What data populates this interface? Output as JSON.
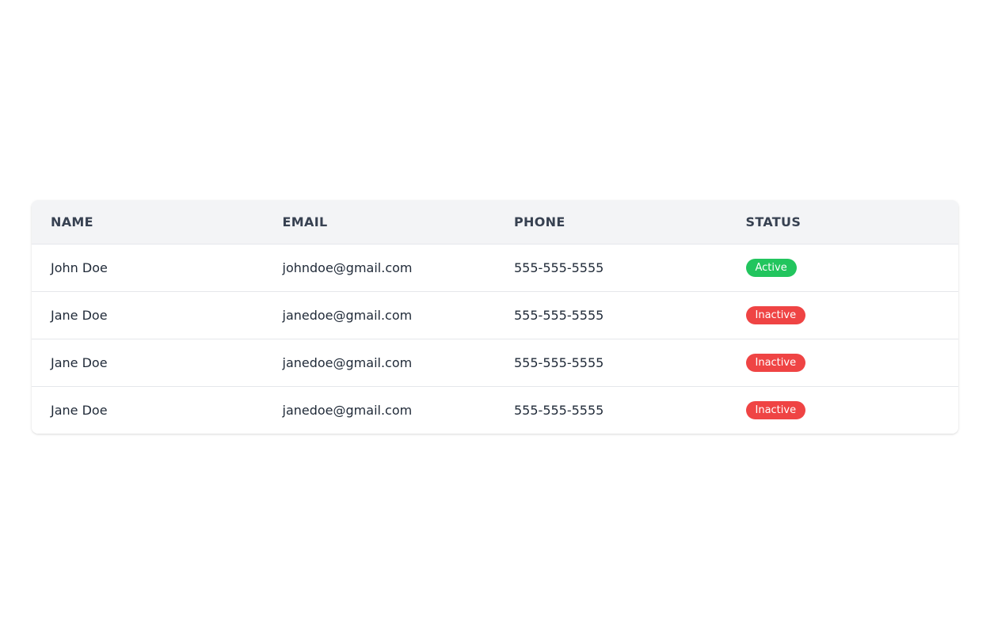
{
  "table": {
    "columns": {
      "name": "NAME",
      "email": "EMAIL",
      "phone": "PHONE",
      "status": "STATUS"
    },
    "rows": [
      {
        "name": "John Doe",
        "email": "johndoe@gmail.com",
        "phone": "555-555-5555",
        "status": "Active"
      },
      {
        "name": "Jane Doe",
        "email": "janedoe@gmail.com",
        "phone": "555-555-5555",
        "status": "Inactive"
      },
      {
        "name": "Jane Doe",
        "email": "janedoe@gmail.com",
        "phone": "555-555-5555",
        "status": "Inactive"
      },
      {
        "name": "Jane Doe",
        "email": "janedoe@gmail.com",
        "phone": "555-555-5555",
        "status": "Inactive"
      }
    ]
  },
  "colors": {
    "active": "#22c55e",
    "inactive": "#ef4444"
  }
}
